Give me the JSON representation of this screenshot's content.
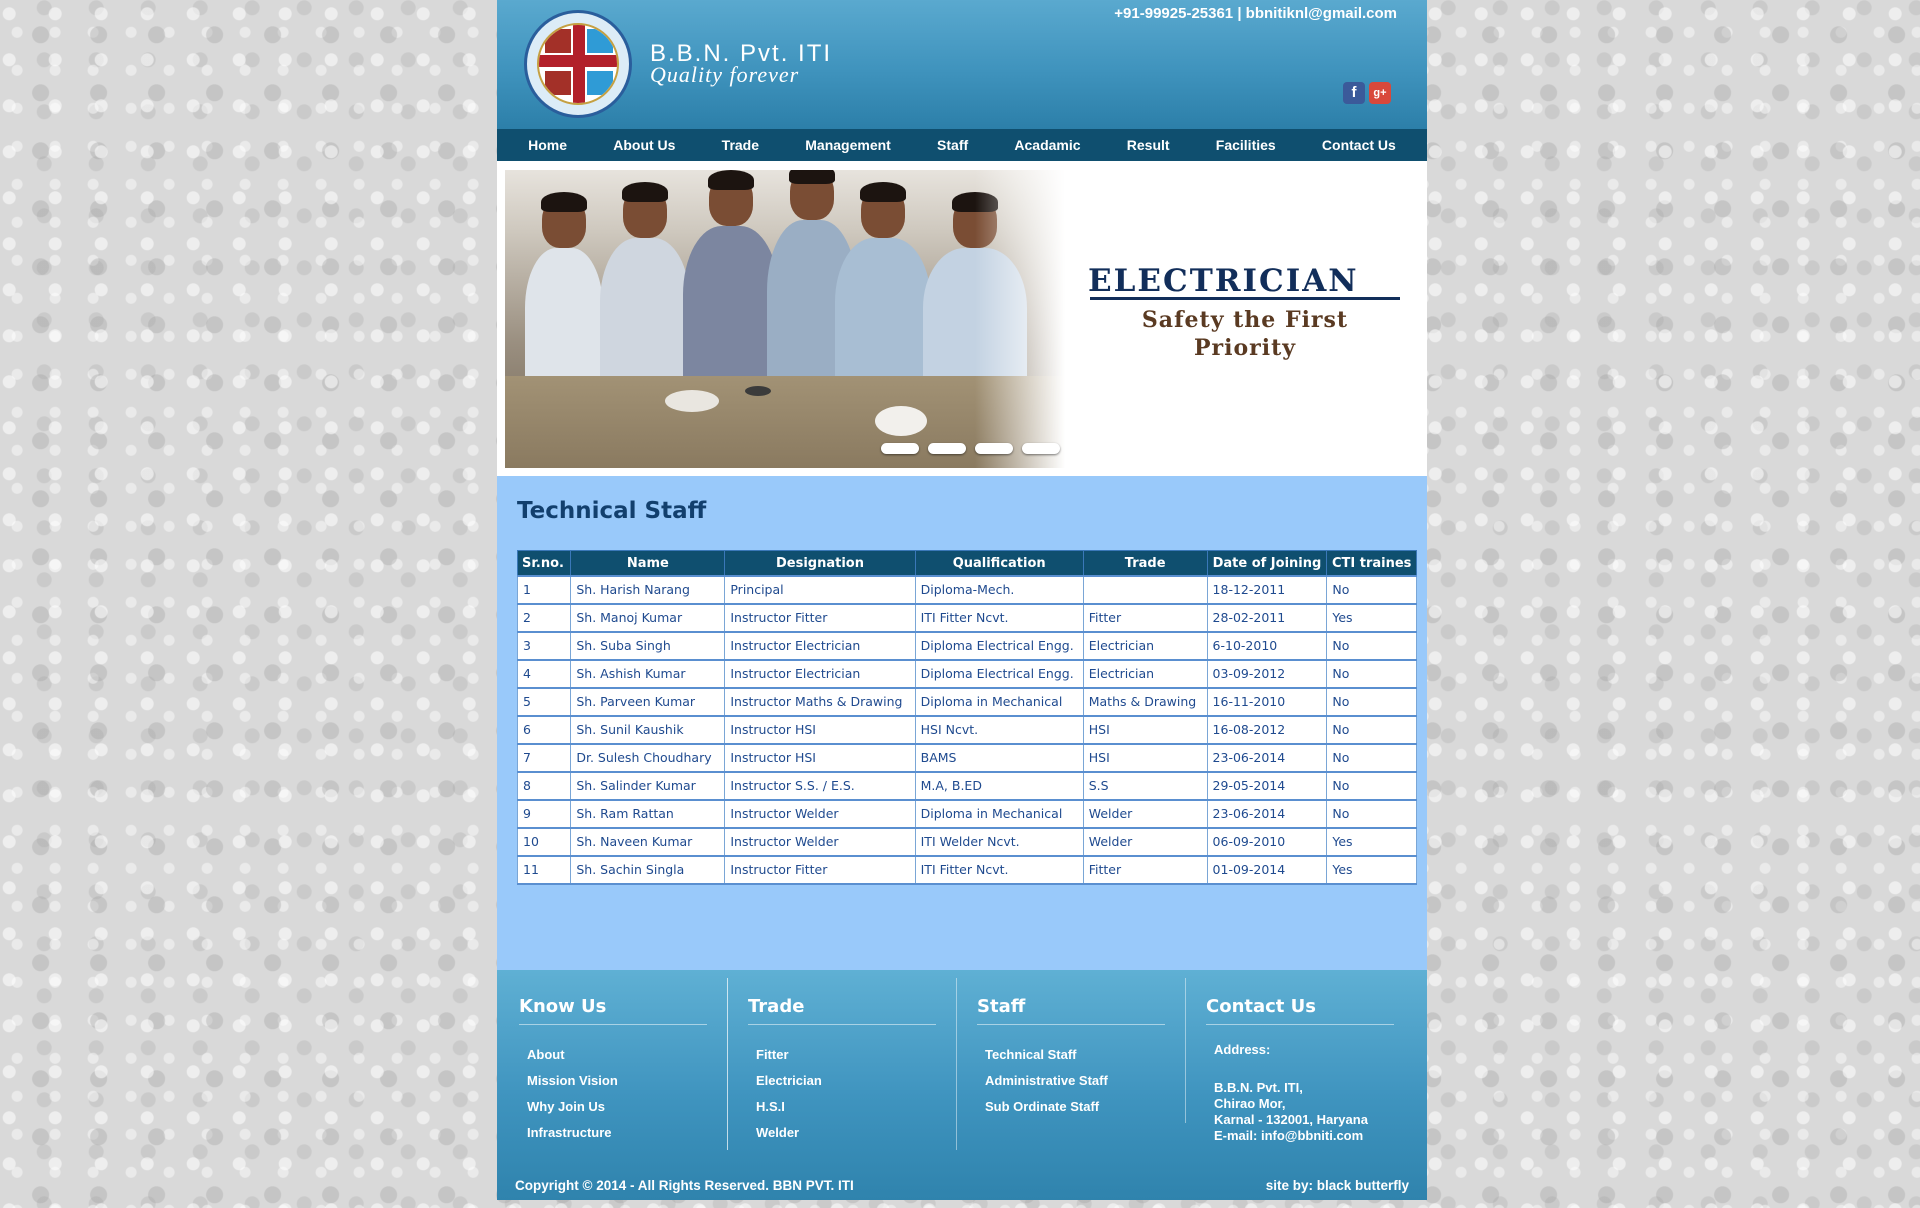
{
  "header": {
    "brand_name": "B.B.N. Pvt. ITI",
    "tagline": "Quality forever",
    "contact": "+91-99925-25361 | bbnitiknl@gmail.com",
    "social": {
      "facebook": "f",
      "google_plus": "g+"
    }
  },
  "nav": {
    "items": [
      "Home",
      "About Us",
      "Trade",
      "Management",
      "Staff",
      "Acadamic",
      "Result",
      "Facilities",
      "Contact Us"
    ]
  },
  "banner": {
    "title": "ELECTRICIAN",
    "subtitle": "Safety the First Priority",
    "slide_count": 4
  },
  "content": {
    "heading": "Technical Staff",
    "columns": [
      "Sr.no.",
      "Name",
      "Designation",
      "Qualification",
      "Trade",
      "Date of Joining",
      "CTI traines"
    ],
    "rows": [
      [
        "1",
        "Sh. Harish Narang",
        "Principal",
        "Diploma-Mech.",
        "",
        "18-12-2011",
        "No"
      ],
      [
        "2",
        "Sh. Manoj Kumar",
        "Instructor Fitter",
        "ITI Fitter Ncvt.",
        "Fitter",
        "28-02-2011",
        "Yes"
      ],
      [
        "3",
        "Sh. Suba Singh",
        "Instructor Electrician",
        "Diploma Electrical Engg.",
        "Electrician",
        "6-10-2010",
        "No"
      ],
      [
        "4",
        "Sh. Ashish Kumar",
        "Instructor Electrician",
        "Diploma Electrical Engg.",
        "Electrician",
        "03-09-2012",
        "No"
      ],
      [
        "5",
        "Sh. Parveen Kumar",
        "Instructor Maths & Drawing",
        "Diploma in Mechanical",
        "Maths & Drawing",
        "16-11-2010",
        "No"
      ],
      [
        "6",
        "Sh. Sunil Kaushik",
        "Instructor HSI",
        "HSI Ncvt.",
        "HSI",
        "16-08-2012",
        "No"
      ],
      [
        "7",
        "Dr. Sulesh Choudhary",
        "Instructor HSI",
        "BAMS",
        "HSI",
        "23-06-2014",
        "No"
      ],
      [
        "8",
        "Sh. Salinder Kumar",
        "Instructor S.S. / E.S.",
        "M.A, B.ED",
        "S.S",
        "29-05-2014",
        "No"
      ],
      [
        "9",
        "Sh. Ram Rattan",
        "Instructor Welder",
        "Diploma in Mechanical",
        "Welder",
        "23-06-2014",
        "No"
      ],
      [
        "10",
        "Sh. Naveen Kumar",
        "Instructor Welder",
        "ITI Welder Ncvt.",
        "Welder",
        "06-09-2010",
        "Yes"
      ],
      [
        "11",
        "Sh. Sachin Singla",
        "Instructor Fitter",
        "ITI Fitter Ncvt.",
        "Fitter",
        "01-09-2014",
        "Yes"
      ]
    ]
  },
  "footer": {
    "know_us": {
      "title": "Know Us",
      "links": [
        "About",
        "Mission Vision",
        "Why Join Us",
        "Infrastructure"
      ]
    },
    "trade": {
      "title": "Trade",
      "links": [
        "Fitter",
        "Electrician",
        "H.S.I",
        "Welder"
      ]
    },
    "staff": {
      "title": "Staff",
      "links": [
        "Technical Staff",
        "Administrative Staff",
        "Sub Ordinate Staff"
      ]
    },
    "contact": {
      "title": "Contact Us",
      "address_label": "Address:",
      "lines": [
        "B.B.N. Pvt. ITI,",
        "Chirao Mor,",
        "Karnal - 132001, Haryana",
        "E-mail: info@bbniti.com"
      ]
    },
    "copyright": "Copyright © 2014 - All Rights Reserved. BBN PVT. ITI",
    "credit": "site by: black butterfly"
  },
  "colors": {
    "nav_bg": "#0f4f6f",
    "content_bg": "#99c9fa",
    "heading": "#123f6d",
    "table_text": "#1f4a8f"
  }
}
